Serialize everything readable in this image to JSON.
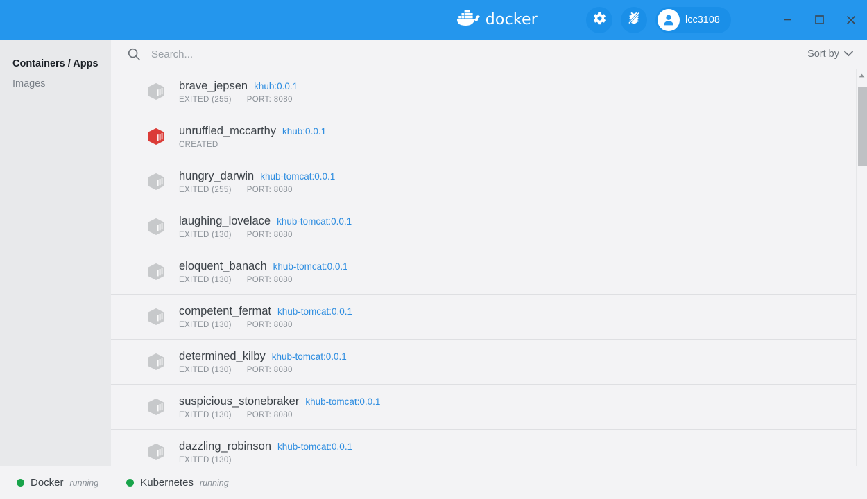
{
  "titlebar": {
    "brand": "docker",
    "brand_icon": "docker-whale-icon",
    "settings_icon": "gear-icon",
    "bug_icon": "bug-slash-icon",
    "user_icon": "user-avatar-icon",
    "username": "lcc3108",
    "minimize_label": "Minimize",
    "maximize_label": "Maximize",
    "close_label": "Close",
    "accent_color": "#2496ED",
    "button_color": "#1A8FE8"
  },
  "sidebar": {
    "items": [
      {
        "label": "Containers / Apps",
        "active": true
      },
      {
        "label": "Images",
        "active": false
      }
    ]
  },
  "search": {
    "icon": "search-icon",
    "placeholder": "Search...",
    "value": ""
  },
  "sort": {
    "label": "Sort by",
    "icon": "chevron-down-icon"
  },
  "containers": [
    {
      "name": "brave_jepsen",
      "image": "khub:0.0.1",
      "state": "EXITED (255)",
      "port": "PORT: 8080",
      "icon": "container-box-icon",
      "icon_color": "#C7C9CB"
    },
    {
      "name": "unruffled_mccarthy",
      "image": "khub:0.0.1",
      "state": "CREATED",
      "port": "",
      "icon": "container-box-icon",
      "icon_color": "#DB3B37"
    },
    {
      "name": "hungry_darwin",
      "image": "khub-tomcat:0.0.1",
      "state": "EXITED (255)",
      "port": "PORT: 8080",
      "icon": "container-box-icon",
      "icon_color": "#C7C9CB"
    },
    {
      "name": "laughing_lovelace",
      "image": "khub-tomcat:0.0.1",
      "state": "EXITED (130)",
      "port": "PORT: 8080",
      "icon": "container-box-icon",
      "icon_color": "#C7C9CB"
    },
    {
      "name": "eloquent_banach",
      "image": "khub-tomcat:0.0.1",
      "state": "EXITED (130)",
      "port": "PORT: 8080",
      "icon": "container-box-icon",
      "icon_color": "#C7C9CB"
    },
    {
      "name": "competent_fermat",
      "image": "khub-tomcat:0.0.1",
      "state": "EXITED (130)",
      "port": "PORT: 8080",
      "icon": "container-box-icon",
      "icon_color": "#C7C9CB"
    },
    {
      "name": "determined_kilby",
      "image": "khub-tomcat:0.0.1",
      "state": "EXITED (130)",
      "port": "PORT: 8080",
      "icon": "container-box-icon",
      "icon_color": "#C7C9CB"
    },
    {
      "name": "suspicious_stonebraker",
      "image": "khub-tomcat:0.0.1",
      "state": "EXITED (130)",
      "port": "PORT: 8080",
      "icon": "container-box-icon",
      "icon_color": "#C7C9CB"
    },
    {
      "name": "dazzling_robinson",
      "image": "khub-tomcat:0.0.1",
      "state": "EXITED (130)",
      "port": "",
      "icon": "container-box-icon",
      "icon_color": "#C7C9CB"
    }
  ],
  "scrollbar": {
    "up_icon": "scroll-up-arrow-icon"
  },
  "statusbar": {
    "items": [
      {
        "label": "Docker",
        "state": "running",
        "color": "#18A34A"
      },
      {
        "label": "Kubernetes",
        "state": "running",
        "color": "#18A34A"
      }
    ]
  }
}
